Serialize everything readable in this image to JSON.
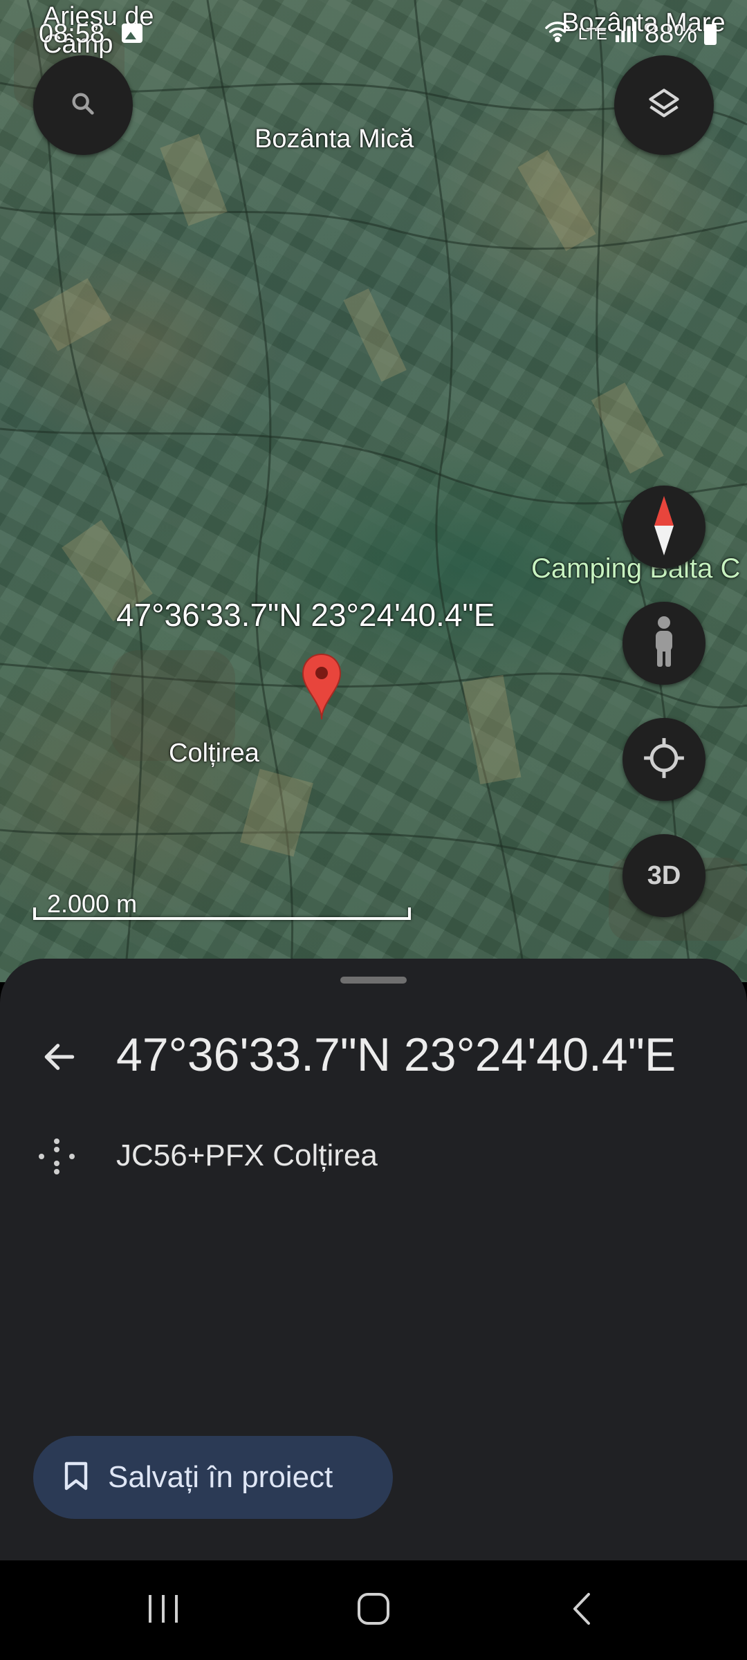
{
  "status_bar": {
    "time": "08:58",
    "battery": "88%",
    "network": "LTE"
  },
  "map": {
    "place_labels": {
      "top_left": "Arieșu de Câmp",
      "top_right": "Bozânta Mare",
      "bozanta_mica": "Bozânta Mică",
      "coltirea": "Colțirea",
      "camping": "Camping Balta C"
    },
    "pin_label": "47°36'33.7\"N 23°24'40.4\"E",
    "scale_label": "2.000 m",
    "buttons": {
      "search_icon": "search-icon",
      "layers_icon": "layers-icon",
      "compass_icon": "compass-icon",
      "street_view_icon": "pegman-icon",
      "my_location_icon": "my-location-icon",
      "view_3d_label": "3D"
    },
    "pin_color": "#e8453c"
  },
  "sheet": {
    "title": "47°36'33.7\"N 23°24'40.4\"E",
    "plus_code": "JC56+PFX Colțirea",
    "save_button_label": "Salvați în proiect",
    "save_button_color": "#2b3a55",
    "background": "#202124"
  },
  "nav_bar": {
    "recents_icon": "recents-icon",
    "home_icon": "home-icon",
    "back_icon": "back-icon"
  }
}
